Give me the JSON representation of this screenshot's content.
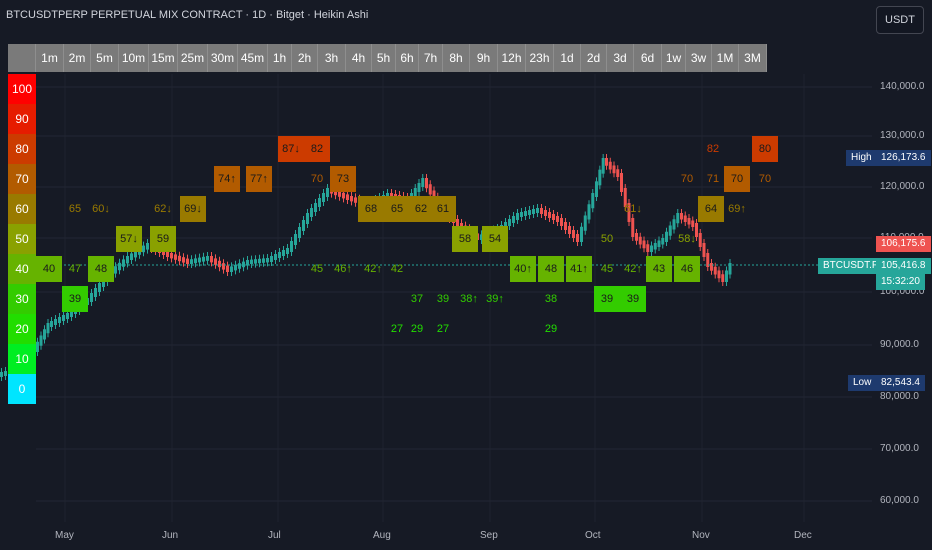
{
  "header": {
    "title": "BTCUSDTPERP PERPETUAL MIX CONTRACT · 1D · Bitget · Heikin Ashi",
    "currency": "USDT"
  },
  "timeframes": [
    "1m",
    "2m",
    "5m",
    "10m",
    "15m",
    "25m",
    "30m",
    "45m",
    "1h",
    "2h",
    "3h",
    "4h",
    "5h",
    "6h",
    "7h",
    "8h",
    "9h",
    "12h",
    "23h",
    "1d",
    "2d",
    "3d",
    "6d",
    "1w",
    "3w",
    "1M",
    "3M"
  ],
  "levels": [
    {
      "label": "100",
      "color": "#ff0000"
    },
    {
      "label": "90",
      "color": "#e61c00"
    },
    {
      "label": "80",
      "color": "#cc3b00"
    },
    {
      "label": "70",
      "color": "#b25b00"
    },
    {
      "label": "60",
      "color": "#997a00"
    },
    {
      "label": "50",
      "color": "#8aa100"
    },
    {
      "label": "40",
      "color": "#66b300"
    },
    {
      "label": "30",
      "color": "#33cc00"
    },
    {
      "label": "20",
      "color": "#22dd00"
    },
    {
      "label": "10",
      "color": "#00ee22"
    },
    {
      "label": "0",
      "color": "#00e5ff"
    }
  ],
  "price_axis": [
    "140,000.0",
    "130,000.0",
    "120,000.0",
    "110,000.0",
    "100,000.0",
    "90,000.0",
    "80,000.0",
    "70,000.0",
    "60,000.0"
  ],
  "time_axis": [
    "May",
    "Jun",
    "Jul",
    "Aug",
    "Sep",
    "Oct",
    "Nov",
    "Dec"
  ],
  "tags": {
    "high_label": "High",
    "high_value": "126,173.6",
    "last_price": "106,175.6",
    "symbol": "BTCUSDT.P",
    "current_price": "105,416.8",
    "countdown": "15:32:20",
    "low_label": "Low",
    "low_value": "82,543.4"
  },
  "colors": {
    "up": "#26a69a",
    "down": "#ef5350",
    "bg": "#161a25"
  },
  "cells": [
    {
      "t": "40",
      "lvl": 6,
      "box": true
    },
    {
      "t": "47",
      "lvl": 6
    },
    {
      "t": "39",
      "lvl": 7,
      "box": true
    },
    {
      "t": "48",
      "lvl": 6,
      "box": true
    },
    {
      "t": "65",
      "lvl": 4
    },
    {
      "t": "60↓",
      "lvl": 4
    },
    {
      "t": "57↓",
      "lvl": 5,
      "box": true
    },
    {
      "t": "59",
      "lvl": 5,
      "box": true
    },
    {
      "t": "62↓",
      "lvl": 4
    },
    {
      "t": "69↓",
      "lvl": 4,
      "box": true
    },
    {
      "t": "74↑",
      "lvl": 3,
      "box": true
    },
    {
      "t": "77↑",
      "lvl": 3,
      "box": true
    },
    {
      "t": "87↓",
      "lvl": 2,
      "box": true
    },
    {
      "t": "82",
      "lvl": 2,
      "box": true
    },
    {
      "t": "70",
      "lvl": 3
    },
    {
      "t": "73",
      "lvl": 3,
      "box": true
    },
    {
      "t": "45",
      "lvl": 6
    },
    {
      "t": "46↑",
      "lvl": 6
    },
    {
      "t": "42↑",
      "lvl": 6
    },
    {
      "t": "42",
      "lvl": 6
    },
    {
      "t": "68",
      "lvl": 4,
      "box": true
    },
    {
      "t": "65",
      "lvl": 4,
      "box": true
    },
    {
      "t": "62",
      "lvl": 4,
      "box": true
    },
    {
      "t": "61",
      "lvl": 4,
      "box": true
    },
    {
      "t": "58",
      "lvl": 5,
      "box": true
    },
    {
      "t": "54",
      "lvl": 5,
      "box": true
    },
    {
      "t": "37",
      "lvl": 7
    },
    {
      "t": "39",
      "lvl": 7
    },
    {
      "t": "38↑",
      "lvl": 7
    },
    {
      "t": "39↑",
      "lvl": 7
    },
    {
      "t": "27",
      "lvl": 8
    },
    {
      "t": "29",
      "lvl": 8
    },
    {
      "t": "27",
      "lvl": 8
    },
    {
      "t": "40↑",
      "lvl": 6,
      "box": true
    },
    {
      "t": "48",
      "lvl": 6,
      "box": true
    },
    {
      "t": "41↑",
      "lvl": 6,
      "box": true
    },
    {
      "t": "45",
      "lvl": 6
    },
    {
      "t": "38",
      "lvl": 7
    },
    {
      "t": "29",
      "lvl": 8
    },
    {
      "t": "50",
      "lvl": 5
    },
    {
      "t": "39",
      "lvl": 7,
      "box": true
    },
    {
      "t": "39",
      "lvl": 7,
      "box": true
    },
    {
      "t": "42↑",
      "lvl": 6
    },
    {
      "t": "61↓",
      "lvl": 4
    },
    {
      "t": "43",
      "lvl": 6,
      "box": true
    },
    {
      "t": "46",
      "lvl": 6,
      "box": true
    },
    {
      "t": "58↓",
      "lvl": 5
    },
    {
      "t": "70",
      "lvl": 3
    },
    {
      "t": "82",
      "lvl": 2
    },
    {
      "t": "71",
      "lvl": 3
    },
    {
      "t": "64",
      "lvl": 4,
      "box": true
    },
    {
      "t": "69↑",
      "lvl": 4
    },
    {
      "t": "70",
      "lvl": 3,
      "box": true
    },
    {
      "t": "80",
      "lvl": 2,
      "box": true
    },
    {
      "t": "70",
      "lvl": 3
    }
  ]
}
